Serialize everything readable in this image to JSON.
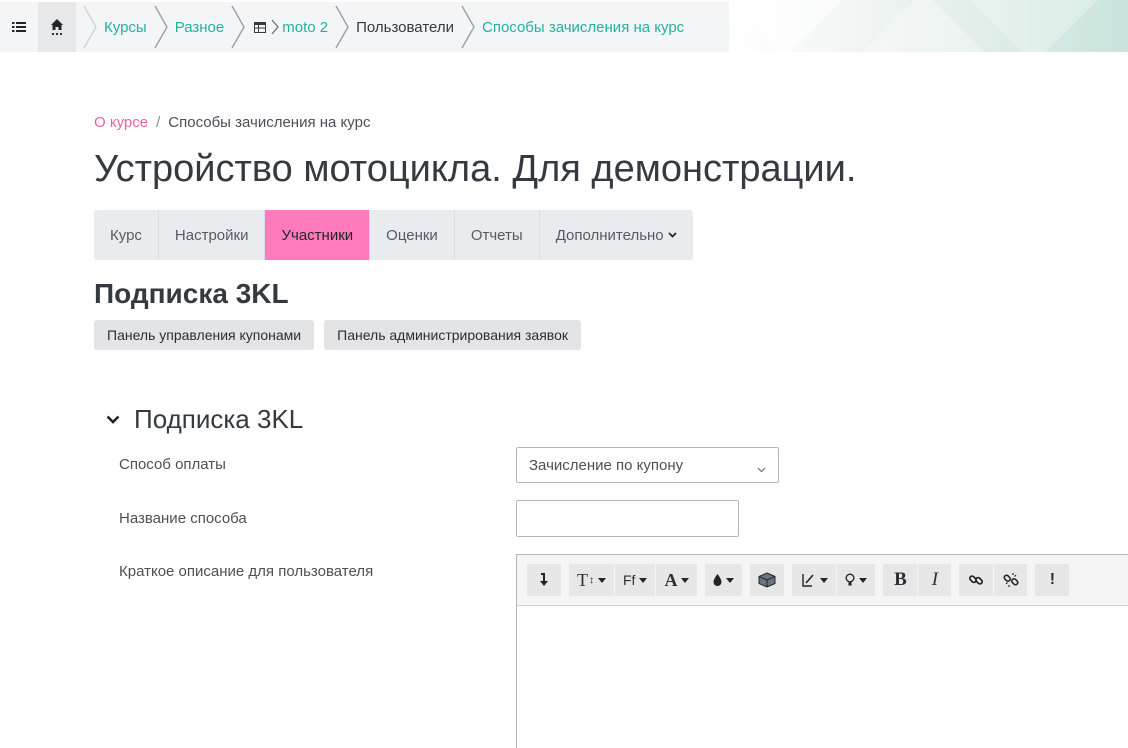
{
  "topbar": {
    "breadcrumbs": [
      "Курсы",
      "Разное",
      "moto 2",
      "Пользователи",
      "Способы зачисления на курс"
    ],
    "icons": [
      "list-icon",
      "home-icon",
      "table-icon"
    ],
    "link_color": "#21b39a"
  },
  "page_breadcrumb": {
    "link": "О курсе",
    "separator": "/",
    "current": "Способы зачисления на курс"
  },
  "course_title": "Устройство мотоцикла. Для демонстрации.",
  "nav": {
    "tabs": [
      "Курс",
      "Настройки",
      "Участники",
      "Оценки",
      "Отчеты",
      "Дополнительно"
    ],
    "active": "Участники",
    "active_color": "#ff7bbd"
  },
  "section_title": "Подписка 3KL",
  "action_buttons": [
    "Панель управления купонами",
    "Панель администрирования заявок"
  ],
  "form": {
    "section_title": "Подписка 3KL",
    "fields": {
      "payment_method": {
        "label": "Способ оплаты",
        "value": "Зачисление по купону"
      },
      "method_name": {
        "label": "Название способа",
        "value": ""
      },
      "short_description": {
        "label": "Краткое описание для пользователя"
      }
    }
  },
  "editor_toolbar": {
    "buttons": [
      "undo-icon",
      "text-size-icon",
      "font-family-icon",
      "font-color-icon",
      "background-color-icon",
      "insert-block-icon",
      "style-icon",
      "hint-icon",
      "bold-icon",
      "italic-icon",
      "link-icon",
      "unlink-icon",
      "more-icon"
    ],
    "labels": {
      "text_size": "T",
      "font": "Ff",
      "color": "A",
      "bold": "B",
      "italic": "I",
      "more": "!"
    }
  }
}
